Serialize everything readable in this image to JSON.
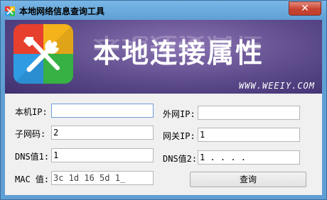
{
  "window": {
    "title": "本地网络信息查询工具",
    "close_label": "✕"
  },
  "banner": {
    "title": "本地连接属性",
    "url": "WWW.WEEIY.COM",
    "logo_icon": "tools-icon"
  },
  "form": {
    "local_ip": {
      "label": "本机IP:",
      "value": ""
    },
    "subnet": {
      "label": "子网码:",
      "value": "2"
    },
    "dns1": {
      "label": "DNS值1:",
      "value": "1"
    },
    "mac": {
      "label": "MAC 值:",
      "value": "3c 1d 16 5d 1_"
    },
    "public_ip": {
      "label": "外网IP:",
      "value": ""
    },
    "gateway": {
      "label": "网关IP:",
      "value": "1"
    },
    "dns2": {
      "label": "DNS值2:",
      "value": "1 . . . ."
    },
    "query_label": "查询"
  },
  "colors": {
    "titlebar": "#78b6e6",
    "banner_bg": "#5c4a8a",
    "close_button": "#c7432f"
  }
}
